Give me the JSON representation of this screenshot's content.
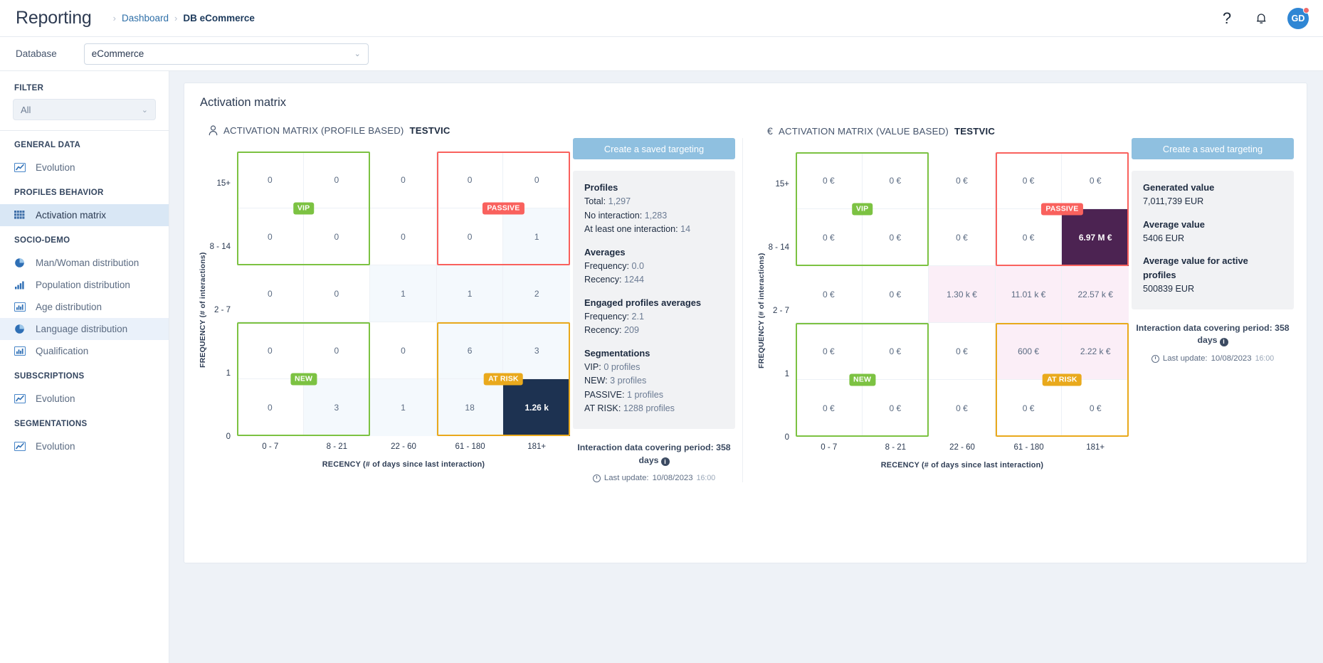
{
  "header": {
    "app_title": "Reporting",
    "breadcrumbs": [
      "Dashboard",
      "DB eCommerce"
    ],
    "breadcrumb_sep": "›",
    "help_icon": "question-mark-icon",
    "bell_icon": "bell-icon",
    "avatar_initials": "GD"
  },
  "database_bar": {
    "label": "Database",
    "selected": "eCommerce",
    "chevron": "⌄"
  },
  "sidebar": {
    "filter_title": "FILTER",
    "filter_value": "All",
    "sections": [
      {
        "title": "GENERAL DATA",
        "items": [
          {
            "label": "Evolution",
            "icon": "line-chart-icon",
            "state": ""
          }
        ]
      },
      {
        "title": "PROFILES BEHAVIOR",
        "items": [
          {
            "label": "Activation matrix",
            "icon": "grid-icon",
            "state": "active"
          }
        ]
      },
      {
        "title": "SOCIO-DEMO",
        "items": [
          {
            "label": "Man/Woman distribution",
            "icon": "pie-chart-icon",
            "state": ""
          },
          {
            "label": "Population distribution",
            "icon": "bar-chart-icon",
            "state": ""
          },
          {
            "label": "Age distribution",
            "icon": "histogram-icon",
            "state": ""
          },
          {
            "label": "Language distribution",
            "icon": "pie-chart-icon",
            "state": "hover"
          },
          {
            "label": "Qualification",
            "icon": "histogram-icon",
            "state": ""
          }
        ]
      },
      {
        "title": "SUBSCRIPTIONS",
        "items": [
          {
            "label": "Evolution",
            "icon": "line-chart-icon",
            "state": ""
          }
        ]
      },
      {
        "title": "SEGMENTATIONS",
        "items": [
          {
            "label": "Evolution",
            "icon": "line-chart-icon",
            "state": ""
          }
        ]
      }
    ]
  },
  "page": {
    "title": "Activation matrix"
  },
  "chart_data": [
    {
      "type": "heatmap",
      "title": "ACTIVATION MATRIX (PROFILE BASED)",
      "title_suffix": "TESTVIC",
      "title_icon": "person-icon",
      "xlabel": "RECENCY (# of days since last interaction)",
      "ylabel": "FREQUENCY (# of interactions)",
      "x_categories": [
        "0 - 7",
        "8 - 21",
        "22 - 60",
        "61 - 180",
        "181+"
      ],
      "y_categories": [
        "15+",
        "8 - 14",
        "2 - 7",
        "1",
        "0"
      ],
      "values": [
        [
          "0",
          "0",
          "0",
          "0",
          "0"
        ],
        [
          "0",
          "0",
          "0",
          "0",
          "1"
        ],
        [
          "0",
          "0",
          "1",
          "1",
          "2"
        ],
        [
          "0",
          "0",
          "0",
          "6",
          "3"
        ],
        [
          "0",
          "3",
          "1",
          "18",
          "1.26 k"
        ]
      ],
      "cell_styles": [
        [
          "",
          "",
          "",
          "",
          ""
        ],
        [
          "",
          "",
          "",
          "",
          "tint"
        ],
        [
          "",
          "",
          "tint",
          "tint",
          "tint"
        ],
        [
          "",
          "",
          "",
          "tint",
          "tint"
        ],
        [
          "",
          "tint",
          "tint",
          "tint",
          "dark"
        ]
      ],
      "segments": [
        {
          "name": "VIP",
          "color": "#7cc242",
          "rows": [
            0,
            1
          ],
          "cols": [
            0,
            1
          ],
          "badge_row": 1,
          "badge_col": 1
        },
        {
          "name": "PASSIVE",
          "color": "#f9615d",
          "rows": [
            0,
            1
          ],
          "cols": [
            3,
            4
          ],
          "badge_row": 1,
          "badge_col": 4
        },
        {
          "name": "NEW",
          "color": "#7cc242",
          "rows": [
            3,
            4
          ],
          "cols": [
            0,
            1
          ],
          "badge_row": 4,
          "badge_col": 1
        },
        {
          "name": "AT RISK",
          "color": "#e9a91c",
          "rows": [
            3,
            4
          ],
          "cols": [
            3,
            4
          ],
          "badge_row": 4,
          "badge_col": 4
        }
      ]
    },
    {
      "type": "heatmap",
      "title": "ACTIVATION MATRIX (VALUE BASED)",
      "title_suffix": "TESTVIC",
      "title_icon": "euro-icon",
      "xlabel": "RECENCY (# of days since last interaction)",
      "ylabel": "FREQUENCY (# of interactions)",
      "x_categories": [
        "0 - 7",
        "8 - 21",
        "22 - 60",
        "61 - 180",
        "181+"
      ],
      "y_categories": [
        "15+",
        "8 - 14",
        "2 - 7",
        "1",
        "0"
      ],
      "values": [
        [
          "0 €",
          "0 €",
          "0 €",
          "0 €",
          "0 €"
        ],
        [
          "0 €",
          "0 €",
          "0 €",
          "0 €",
          "6.97 M €"
        ],
        [
          "0 €",
          "0 €",
          "1.30 k €",
          "11.01 k €",
          "22.57 k €"
        ],
        [
          "0 €",
          "0 €",
          "0 €",
          "600 €",
          "2.22 k €"
        ],
        [
          "0 €",
          "0 €",
          "0 €",
          "0 €",
          "0 €"
        ]
      ],
      "cell_styles": [
        [
          "",
          "",
          "",
          "",
          ""
        ],
        [
          "",
          "",
          "",
          "",
          "purple"
        ],
        [
          "",
          "",
          "pink",
          "pink",
          "pink"
        ],
        [
          "",
          "",
          "",
          "pink",
          "pink"
        ],
        [
          "",
          "",
          "",
          "",
          ""
        ]
      ],
      "segments": [
        {
          "name": "VIP",
          "color": "#7cc242",
          "rows": [
            0,
            1
          ],
          "cols": [
            0,
            1
          ],
          "badge_row": 1,
          "badge_col": 1
        },
        {
          "name": "PASSIVE",
          "color": "#f9615d",
          "rows": [
            0,
            1
          ],
          "cols": [
            3,
            4
          ],
          "badge_row": 1,
          "badge_col": 4
        },
        {
          "name": "NEW",
          "color": "#7cc242",
          "rows": [
            3,
            4
          ],
          "cols": [
            0,
            1
          ],
          "badge_row": 4,
          "badge_col": 1
        },
        {
          "name": "AT RISK",
          "color": "#e9a91c",
          "rows": [
            3,
            4
          ],
          "cols": [
            3,
            4
          ],
          "badge_row": 4,
          "badge_col": 4
        }
      ]
    }
  ],
  "stats_left": {
    "cta_label": "Create a saved targeting",
    "groups": [
      {
        "heading": "Profiles",
        "lines": [
          {
            "label": "Total:",
            "value": "1,297"
          },
          {
            "label": "No interaction:",
            "value": "1,283"
          },
          {
            "label": "At least one interaction:",
            "value": "14"
          }
        ]
      },
      {
        "heading": "Averages",
        "lines": [
          {
            "label": "Frequency:",
            "value": "0.0"
          },
          {
            "label": "Recency:",
            "value": "1244"
          }
        ]
      },
      {
        "heading": "Engaged profiles averages",
        "lines": [
          {
            "label": "Frequency:",
            "value": "2.1"
          },
          {
            "label": "Recency:",
            "value": "209"
          }
        ]
      },
      {
        "heading": "Segmentations",
        "lines": [
          {
            "label": "VIP:",
            "value": "0 profiles"
          },
          {
            "label": "NEW:",
            "value": "3 profiles"
          },
          {
            "label": "PASSIVE:",
            "value": "1 profiles"
          },
          {
            "label": "AT RISK:",
            "value": "1288 profiles"
          }
        ]
      }
    ],
    "covering": "Interaction data covering period: 358 days",
    "last_update_label": "Last update:",
    "last_update_date": "10/08/2023",
    "last_update_time": "16:00"
  },
  "stats_right": {
    "cta_label": "Create a saved targeting",
    "groups": [
      {
        "heading": "Generated value",
        "lines": [
          {
            "label": "7,011,739 EUR",
            "value": ""
          }
        ]
      },
      {
        "heading": "Average value",
        "lines": [
          {
            "label": "5406 EUR",
            "value": ""
          }
        ]
      },
      {
        "heading": "Average value for active profiles",
        "lines": [
          {
            "label": "500839 EUR",
            "value": ""
          }
        ]
      }
    ],
    "covering": "Interaction data covering period: 358 days",
    "last_update_label": "Last update:",
    "last_update_date": "10/08/2023",
    "last_update_time": "16:00"
  }
}
